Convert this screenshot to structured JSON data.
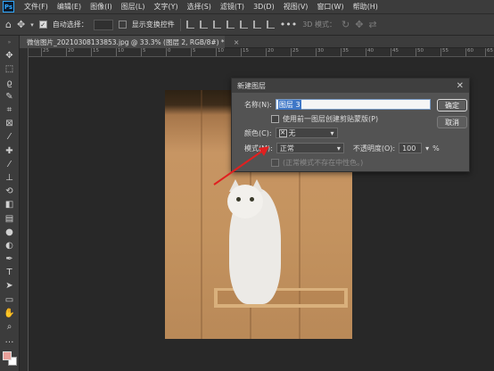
{
  "menubar": {
    "logo": "Ps",
    "items": [
      "文件(F)",
      "编辑(E)",
      "图像(I)",
      "图层(L)",
      "文字(Y)",
      "选择(S)",
      "滤镜(T)",
      "3D(D)",
      "视图(V)",
      "窗口(W)",
      "帮助(H)"
    ]
  },
  "options": {
    "auto_select_label": "自动选择：",
    "show_transform_label": "显示变换控件",
    "mode_3d_label": "3D 模式："
  },
  "document": {
    "tab_title": "微信图片_20210308133853.jpg @ 33.3% (图层 2, RGB/8#) *",
    "close_glyph": "×"
  },
  "ruler": {
    "ticks": [
      "25",
      "20",
      "15",
      "10",
      "5",
      "0",
      "5",
      "10",
      "15",
      "20",
      "25",
      "30",
      "35",
      "40",
      "45",
      "50",
      "55",
      "60",
      "65"
    ]
  },
  "dialog": {
    "title": "新建图层",
    "name_label": "名称(N):",
    "name_value": "图层 3",
    "clip_label": "使用前一图层创建剪贴蒙版(P)",
    "color_label": "颜色(C):",
    "color_value": "无",
    "mode_label": "模式(M):",
    "mode_value": "正常",
    "opacity_label": "不透明度(O):",
    "opacity_value": "100",
    "opacity_unit": "%",
    "neutral_hint": "(正常模式不存在中性色。)",
    "ok_label": "确定",
    "cancel_label": "取消"
  },
  "colors": {
    "accent": "#31a8ff",
    "foreground_swatch": "#e9a09a",
    "background_swatch": "#ffffff",
    "annotation_arrow": "#e02020"
  }
}
